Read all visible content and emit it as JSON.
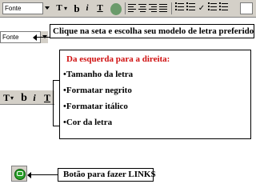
{
  "toolbar": {
    "font_value": "Fonte",
    "font_size_icon": "T",
    "bold_label": "b",
    "italic_label": "i",
    "color_label": "T"
  },
  "callout": {
    "text": "Clique na seta e escolha seu modelo de letra preferido"
  },
  "font_select_zoom": {
    "value": "Fonte"
  },
  "panel": {
    "title": "Da esquerda para a direita:",
    "items": [
      "•Tamanho da letra",
      "•Formatar negrito",
      "•Formatar itálico",
      "•Cor da letra"
    ]
  },
  "side_toolbar": {
    "size_label": "T",
    "bold_label": "b",
    "italic_label": "i",
    "color_label": "T"
  },
  "link": {
    "label": "Botão para fazer LINKS",
    "icon": "link-icon"
  },
  "colors": {
    "title_red": "#d01010",
    "toolbar_gray": "#d4d0c8"
  }
}
